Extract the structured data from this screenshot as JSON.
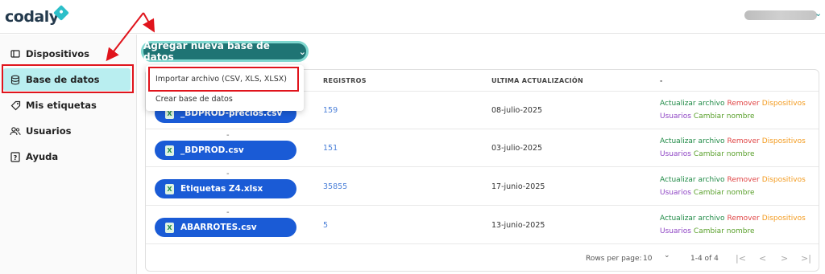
{
  "app": {
    "logo_text": "codaly"
  },
  "sidebar": {
    "items": [
      {
        "label": "Dispositivos",
        "icon": "device-icon"
      },
      {
        "label": "Base de datos",
        "icon": "database-icon",
        "active": true
      },
      {
        "label": "Mis etiquetas",
        "icon": "tag-icon"
      },
      {
        "label": "Usuarios",
        "icon": "users-icon"
      },
      {
        "label": "Ayuda",
        "icon": "help-icon"
      }
    ]
  },
  "toolbar": {
    "add_label": "Agregar nueva base de datos",
    "add_icon": "chevron-down-icon"
  },
  "dropdown": {
    "items": [
      {
        "label": "Importar archivo (CSV, XLS, XLSX)"
      },
      {
        "label": "Crear base de datos"
      }
    ]
  },
  "table": {
    "headers": {
      "registros": "REGISTROS",
      "ultima": "ULTIMA ACTUALIZACIÓN",
      "acciones": "-"
    },
    "rows": [
      {
        "dash": "",
        "file": "_BDPROD-precios.csv",
        "registros": "159",
        "fecha": "08-julio-2025"
      },
      {
        "dash": "-",
        "file": "_BDPROD.csv",
        "registros": "151",
        "fecha": "03-julio-2025"
      },
      {
        "dash": "-",
        "file": "Etiquetas Z4.xlsx",
        "registros": "35855",
        "fecha": "17-junio-2025"
      },
      {
        "dash": "-",
        "file": "ABARROTES.csv",
        "registros": "5",
        "fecha": "13-junio-2025"
      }
    ],
    "actions": {
      "actualizar": "Actualizar archivo",
      "remover": "Remover",
      "dispositivos": "Dispositivos",
      "usuarios": "Usuarios",
      "cambiar": "Cambiar nombre"
    }
  },
  "pagination": {
    "rows_label": "Rows per page:",
    "rows_value": "10",
    "range": "1-4 of 4",
    "first": "|<",
    "prev": "<",
    "next": ">",
    "last": ">|"
  },
  "colors": {
    "accent": "#1f7474",
    "file_pill": "#1a5bd6",
    "sidebar_active": "#b9eef0",
    "highlight": "#e0141c"
  }
}
